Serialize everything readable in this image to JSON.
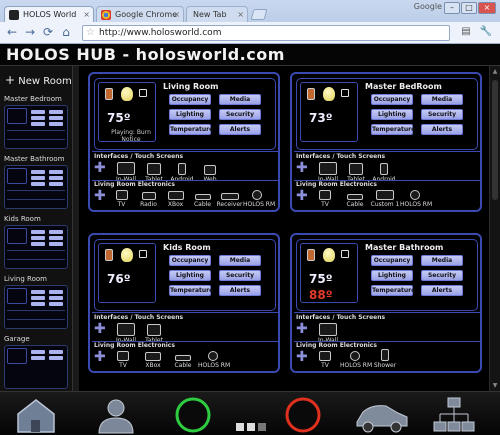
{
  "browser": {
    "tabs": [
      {
        "label": "HOLOS World",
        "active": true
      },
      {
        "label": "Google Chrome",
        "active": false
      },
      {
        "label": "New Tab",
        "active": false
      }
    ],
    "top_right_label": "Google",
    "url": "http://www.holosworld.com"
  },
  "app": {
    "title": "HOLOS HUB - holosworld.com",
    "new_room_label": "New Room",
    "sidebar_rooms": [
      {
        "name": "Master Bedroom"
      },
      {
        "name": "Master Bathroom"
      },
      {
        "name": "Kids Room"
      },
      {
        "name": "Living Room"
      },
      {
        "name": "Garage"
      }
    ],
    "section_interfaces": "Interfaces / Touch Screens",
    "button_labels": {
      "occupancy": "Occupancy",
      "media": "Media",
      "lighting": "Lighting",
      "security": "Security",
      "temperature": "Temperature",
      "alerts": "Alerts"
    },
    "rooms": [
      {
        "name": "Living Room",
        "temp": "75º",
        "status": "Playing: Burn Notice",
        "electronics_title": "Living Room Electronics",
        "interfaces": [
          "In-Wall",
          "Tablet",
          "Android",
          "Web"
        ],
        "electronics": [
          "TV",
          "Radio",
          "XBox",
          "Cable",
          "Receiver",
          "HOLOS RM"
        ]
      },
      {
        "name": "Master BedRoom",
        "temp": "73º",
        "electronics_title": "Living Room Electronics",
        "interfaces": [
          "In-Wall",
          "Tablet",
          "Android"
        ],
        "electronics": [
          "TV",
          "Cable",
          "Custom 1",
          "HOLOS RM"
        ]
      },
      {
        "name": "Kids Room",
        "temp": "76º",
        "electronics_title": "Living Room Electronics",
        "interfaces": [
          "In-Wall",
          "Tablet"
        ],
        "electronics": [
          "TV",
          "XBox",
          "Cable",
          "HOLOS RM"
        ]
      },
      {
        "name": "Master Bathroom",
        "temp": "75º",
        "temp_alert": "88º",
        "electronics_title": "Living Room Electronics",
        "interfaces": [
          "In-Wall"
        ],
        "electronics": [
          "TV",
          "HOLOS RM",
          "Shower"
        ]
      }
    ]
  },
  "colors": {
    "accent": "#3b4ab0",
    "button": "#aab3ef",
    "alert_temp": "#e23a2a",
    "go_ring": "#2ecc40",
    "stop_ring": "#e0301e"
  }
}
